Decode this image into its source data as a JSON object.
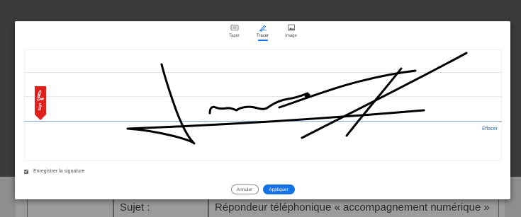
{
  "background_doc": {
    "row": [
      "",
      "Sujet :",
      "Répondeur téléphonique « accompagnement numérique »"
    ]
  },
  "tabs": [
    {
      "label": "Taper",
      "icon": "keyboard-icon"
    },
    {
      "label": "Tracer",
      "icon": "draw-pen-icon",
      "active": true
    },
    {
      "label": "Image",
      "icon": "image-icon"
    }
  ],
  "signature_pad": {
    "clear_label": "Effacer",
    "sign_tag_label": "Sign",
    "sign_tag_icon": "adobe-acrobat-icon"
  },
  "save_signature": {
    "label": "Enregistrer la signature",
    "checked": true
  },
  "actions": {
    "cancel_label": "Annuler",
    "apply_label": "Appliquer"
  },
  "colors": {
    "accent": "#1473e6",
    "sign_tag": "#e0201c",
    "baseline": "#7fa8d8",
    "ink": "#000000"
  }
}
